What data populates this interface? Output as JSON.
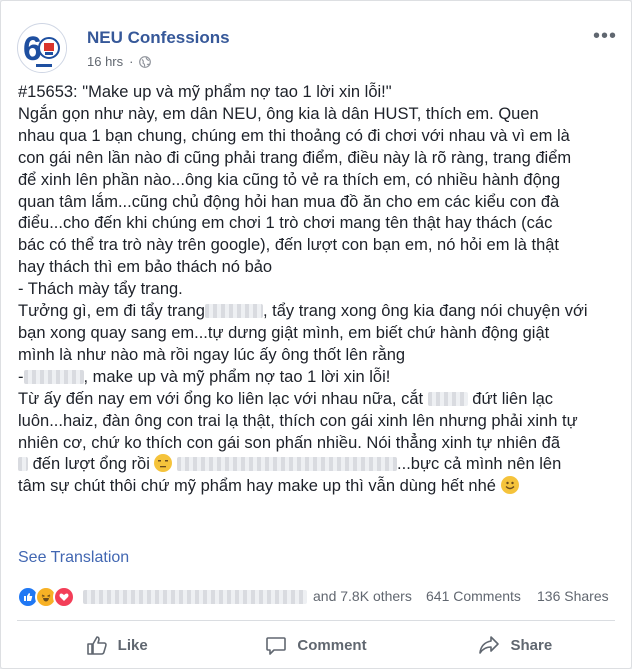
{
  "post": {
    "page_name": "NEU Confessions",
    "time": "16 hrs",
    "privacy_icon": "globe-icon",
    "more_icon": "more-options-icon",
    "lines": [
      "#15653: \"Make up và mỹ phẩm nợ tao 1 lời xin lỗi!\"",
      "Ngắn gọn như này, em dân NEU, ông kia là dân HUST, thích em. Quen",
      "nhau qua 1 bạn chung, chúng em thi thoảng có đi chơi với nhau và vì em là",
      "con gái nên lần nào đi cũng phải trang điểm, điều này là rõ ràng, trang điểm",
      "để xinh lên phần nào...ông kia cũng tỏ vẻ ra thích em, có nhiều hành động",
      "quan tâm lắm...cũng chủ động hỏi han mua đồ ăn cho em các kiểu con đà",
      "điểu...cho đến khi chúng em chơi 1 trò chơi mang tên thật hay thách (các",
      "bác có thể tra trò này trên google), đến lượt con bạn em, nó hỏi em là thật",
      "hay thách thì em bảo thách nó bảo",
      "- Thách mày tẩy trang.",
      "Tưởng gì, em đi tẩy trang",
      ", tẩy trang xong ông kia đang nói chuyện với",
      "bạn xong quay sang em...tự dưng giật mình, em biết chứ hành động giật",
      "mình là như nào mà rồi ngay lúc ấy ông thốt lên rằng",
      "-",
      ", make up và mỹ phẩm nợ tao 1 lời xin lỗi!",
      "Từ ấy đến nay em với ổng ko liên lạc với nhau nữa, cắt",
      "đứt liên lạc",
      "luôn...haiz, đàn ông con trai lạ thật, thích con gái xinh lên nhưng phải xinh tự",
      "nhiên cơ, chứ ko thích con gái son phấn nhiều. Nói thẳng xinh tự nhiên đã",
      "đến lượt ổng rồi",
      "...bực cả mình nên lên",
      "tâm sự chút thôi chứ mỹ phẩm hay make up thì vẫn dùng hết nhé"
    ],
    "see_translation": "See Translation"
  },
  "reactions": {
    "icons": [
      "like-reaction-icon",
      "haha-reaction-icon",
      "love-reaction-icon"
    ],
    "others": "and 7.8K others",
    "comments": "641 Comments",
    "shares": "136 Shares"
  },
  "actions": {
    "like": "Like",
    "comment": "Comment",
    "share": "Share"
  },
  "colors": {
    "link": "#365899",
    "translation": "#4267b2",
    "text": "#1d2129",
    "meta": "#616770"
  }
}
